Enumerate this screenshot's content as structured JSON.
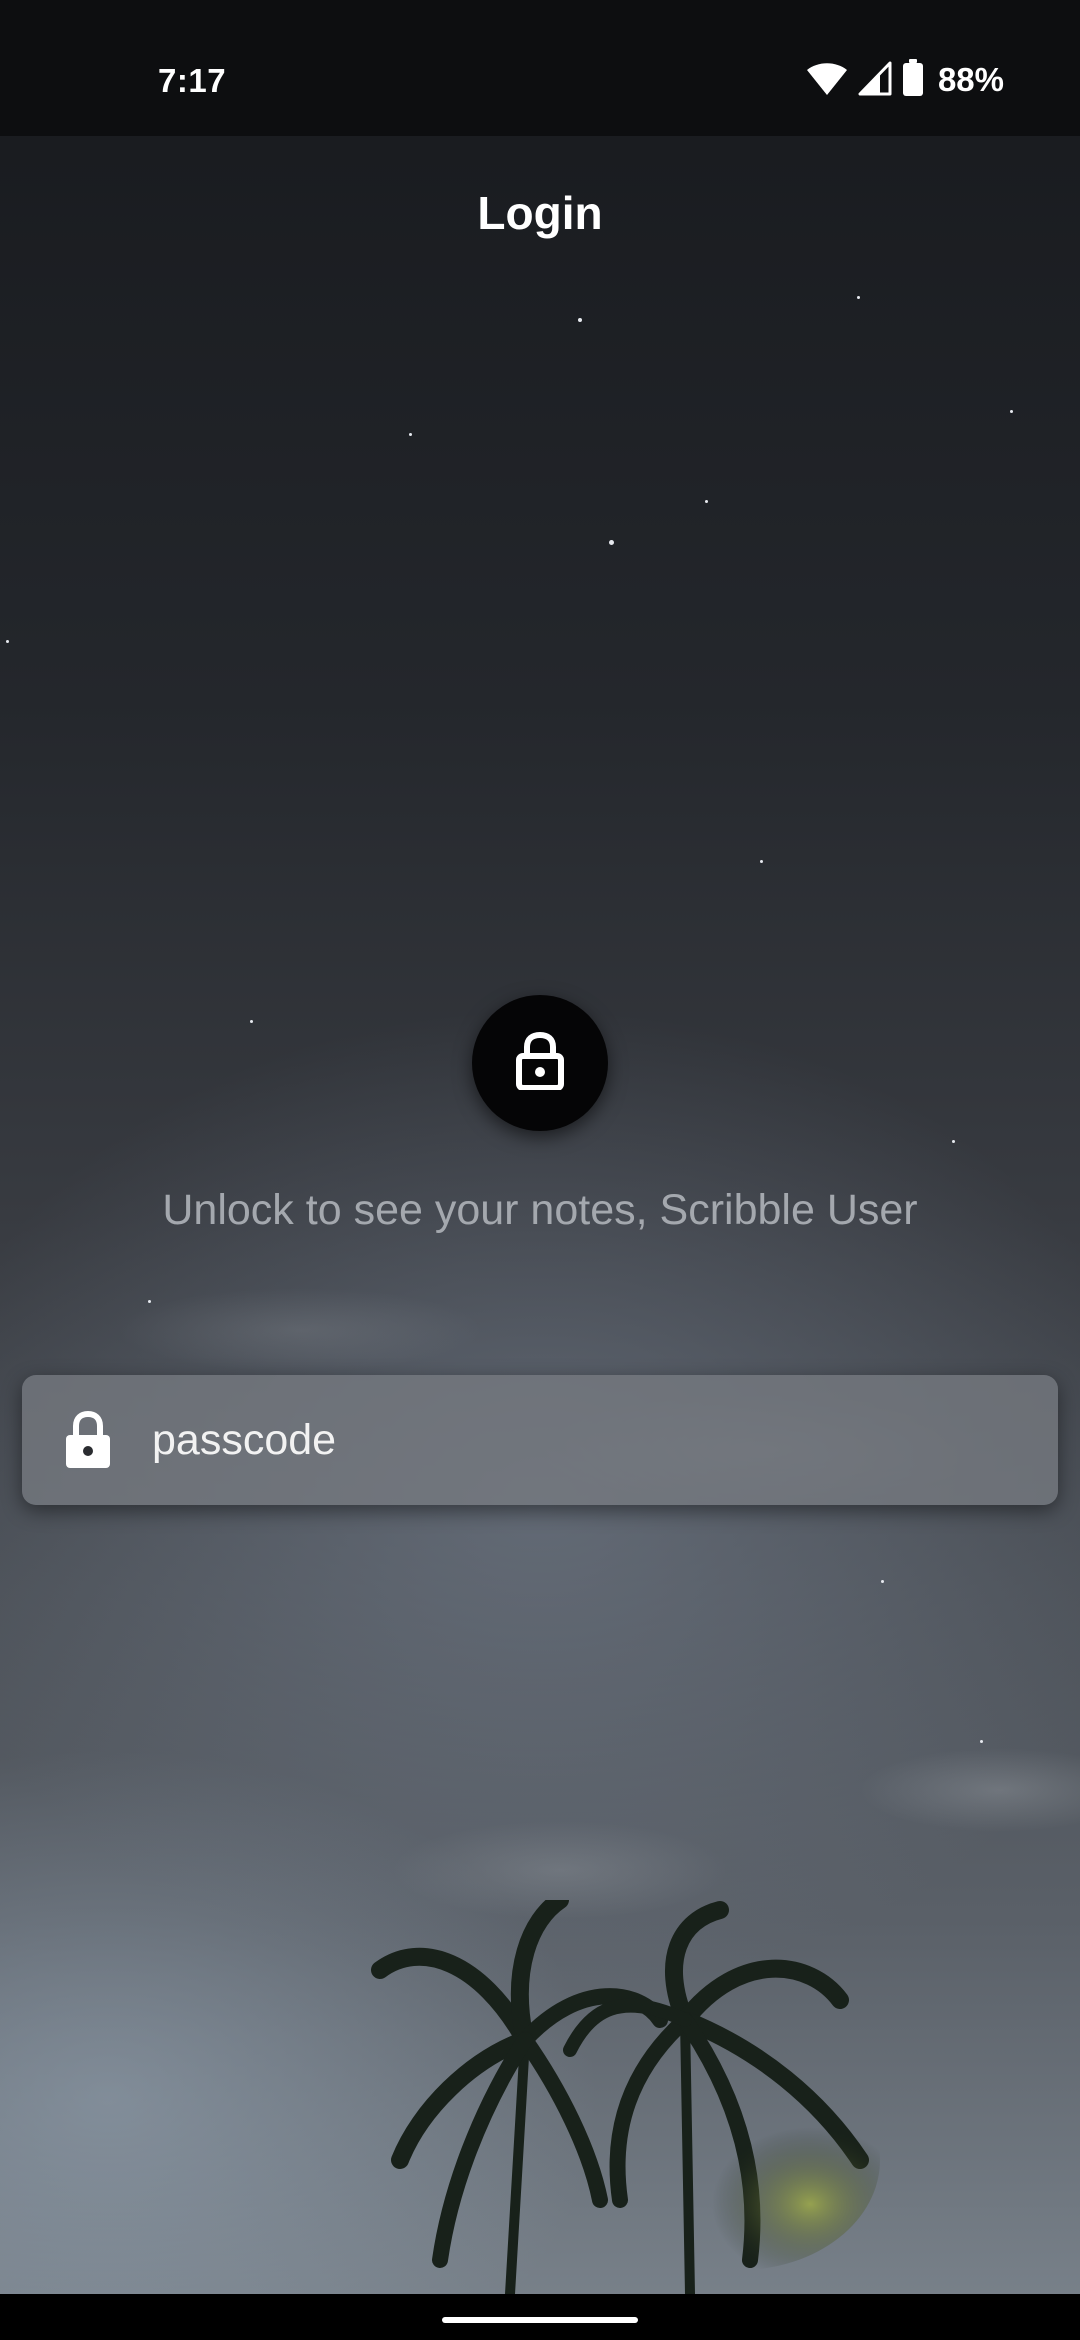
{
  "status_bar": {
    "time": "7:17",
    "battery_percent": "88%",
    "icons": [
      "wifi-icon",
      "cellular-signal-icon",
      "battery-icon"
    ]
  },
  "header": {
    "title": "Login"
  },
  "lock_screen": {
    "lock_icon": "lock-icon",
    "message": "Unlock to see your notes, Scribble User"
  },
  "passcode_field": {
    "placeholder": "passcode",
    "value": "",
    "icon": "lock-icon"
  },
  "navigation": {
    "home_indicator": "home-pill"
  },
  "colors": {
    "status_bar_bg": "#0d0e10",
    "lock_circle_bg": "#050506",
    "field_bg": "#767a80",
    "subtitle_text": "#a4a8ae"
  }
}
